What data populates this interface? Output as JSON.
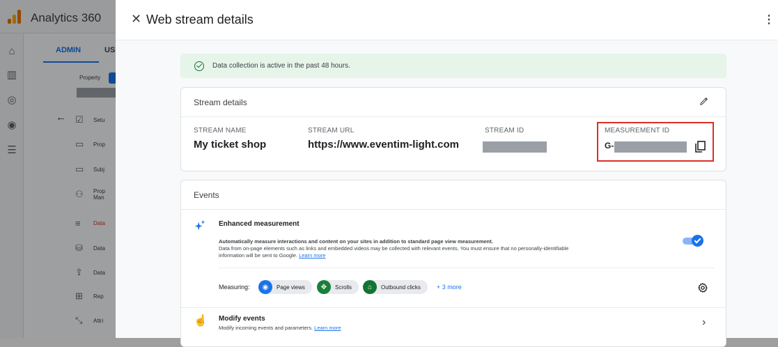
{
  "app": {
    "name": "Analytics 360"
  },
  "admin_nav": {
    "tabs": [
      {
        "label": "ADMIN"
      },
      {
        "label": "US"
      }
    ],
    "property_label": "Property",
    "menu_items": [
      {
        "label": "Setu"
      },
      {
        "label": "Prop"
      },
      {
        "label": "Subj"
      },
      {
        "label": "Prop",
        "label2": "Man"
      },
      {
        "label": "Data"
      },
      {
        "label": "Data"
      },
      {
        "label": "Data"
      },
      {
        "label": "Rep"
      },
      {
        "label": "Attri"
      }
    ]
  },
  "panel": {
    "title": "Web stream details",
    "close_icon": "close-icon",
    "more_icon": "more-vert-icon"
  },
  "banner": {
    "text": "Data collection is active in the past 48 hours.",
    "color": "#e6f4ea"
  },
  "stream_details": {
    "heading": "Stream details",
    "stream_name_label": "STREAM NAME",
    "stream_name": "My ticket shop",
    "stream_url_label": "STREAM URL",
    "stream_url": "https://www.eventim-light.com",
    "stream_id_label": "STREAM ID",
    "measurement_id_label": "MEASUREMENT ID",
    "measurement_id_prefix": "G-",
    "highlight_color": "#d93025"
  },
  "events": {
    "heading": "Events",
    "enhanced": {
      "title": "Enhanced measurement",
      "line1": "Automatically measure interactions and content on your sites in addition to standard page view measurement.",
      "line2": "Data from on-page elements such as links and embedded videos may be collected with relevant events. You must ensure that no personally-identifiable",
      "line3": "information will be sent to Google.",
      "learn_more": "Learn more",
      "enabled": true
    },
    "measuring": {
      "label": "Measuring:",
      "chips": [
        {
          "label": "Page views",
          "icon": "eye-icon",
          "color": "#1a73e8"
        },
        {
          "label": "Scrolls",
          "icon": "scroll-icon",
          "color": "#188038"
        },
        {
          "label": "Outbound clicks",
          "icon": "mouse-icon",
          "color": "#137333"
        }
      ],
      "more": "+ 3 more"
    },
    "modify": {
      "title": "Modify events",
      "desc": "Modify incoming events and parameters.",
      "learn_more": "Learn more"
    }
  },
  "colors": {
    "accent": "#1a73e8"
  }
}
